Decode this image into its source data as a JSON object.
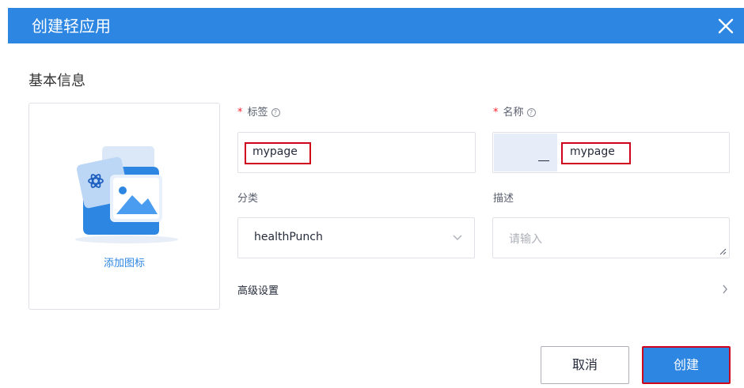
{
  "dialog": {
    "title": "创建轻应用"
  },
  "section": {
    "title": "基本信息"
  },
  "icon_card": {
    "caption": "添加图标"
  },
  "form": {
    "label_field": {
      "label": "标签",
      "value": "mypage"
    },
    "name_field": {
      "label": "名称",
      "value": "mypage"
    },
    "category_field": {
      "label": "分类",
      "value": "healthPunch"
    },
    "description_field": {
      "label": "描述",
      "placeholder": "请输入"
    },
    "required_mark": "*",
    "help_mark": "?"
  },
  "advanced": {
    "label": "高级设置"
  },
  "footer": {
    "cancel_label": "取消",
    "create_label": "创建"
  },
  "colors": {
    "primary": "#2d86e2",
    "highlight": "#d0021b",
    "required": "#f5222d"
  }
}
